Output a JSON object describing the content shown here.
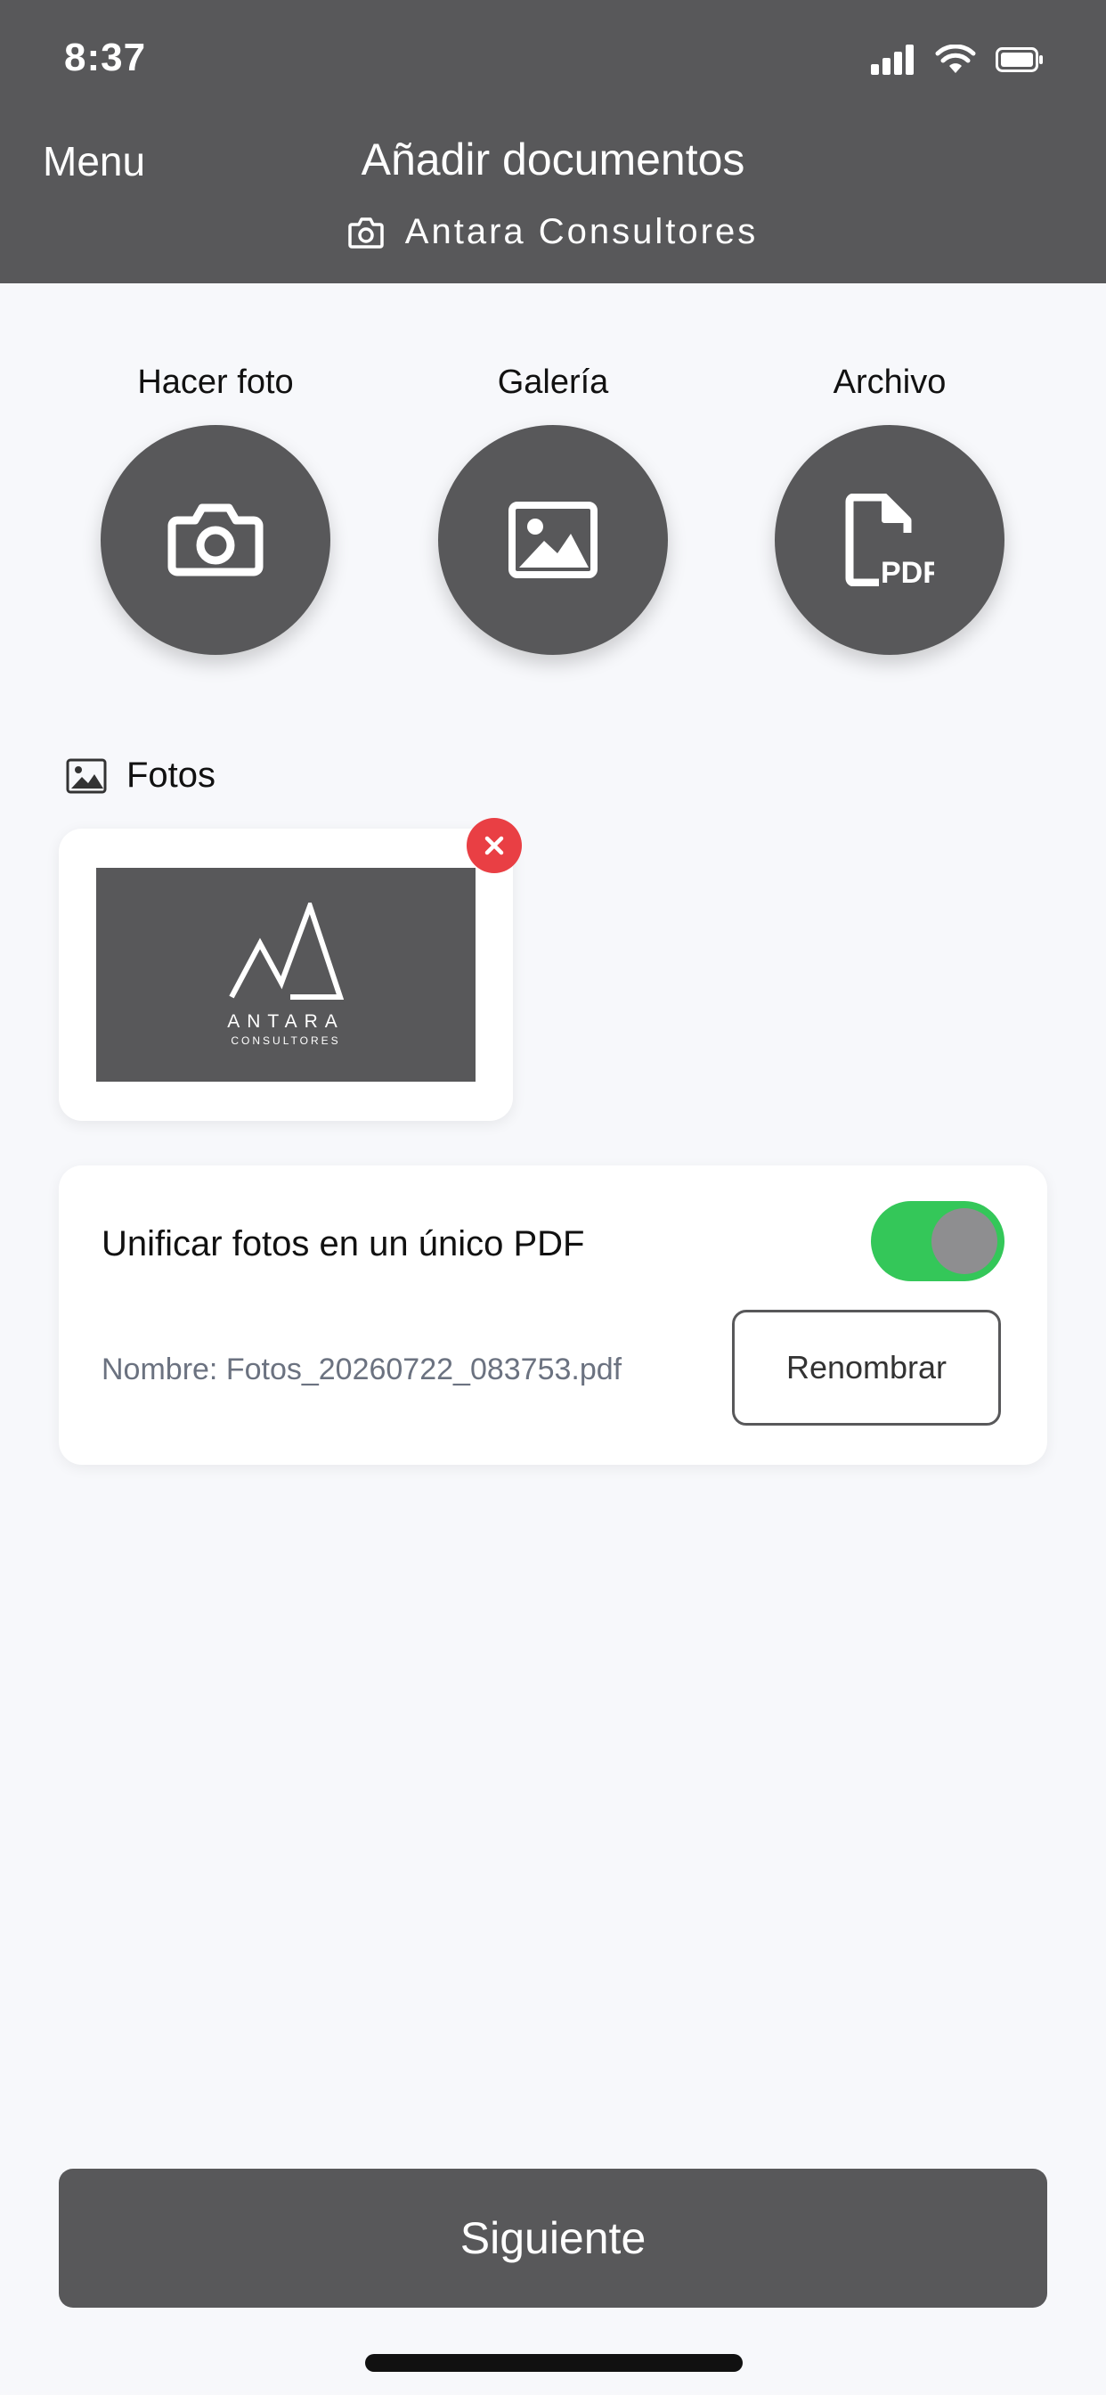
{
  "status": {
    "time": "8:37"
  },
  "header": {
    "menu_label": "Menu",
    "title": "Añadir documentos",
    "subtitle": "Antara Consultores",
    "subtitle_icon": "camera-icon"
  },
  "actions": [
    {
      "label": "Hacer foto",
      "icon": "camera-icon"
    },
    {
      "label": "Galería",
      "icon": "image-icon"
    },
    {
      "label": "Archivo",
      "icon": "pdf-file-icon"
    }
  ],
  "photos": {
    "section_title": "Fotos",
    "items": [
      {
        "logo_text": "ANTARA",
        "logo_subtext": "CONSULTORES"
      }
    ]
  },
  "merge_option": {
    "label": "Unificar fotos en un único PDF",
    "enabled": true,
    "filename": "Nombre: Fotos_20260722_083753.pdf",
    "rename_label": "Renombrar"
  },
  "footer": {
    "next_label": "Siguiente"
  },
  "colors": {
    "header_bg": "#58585a",
    "accent_green": "#34c759",
    "delete_red": "#e93f44",
    "page_bg": "#f7f8fb"
  }
}
